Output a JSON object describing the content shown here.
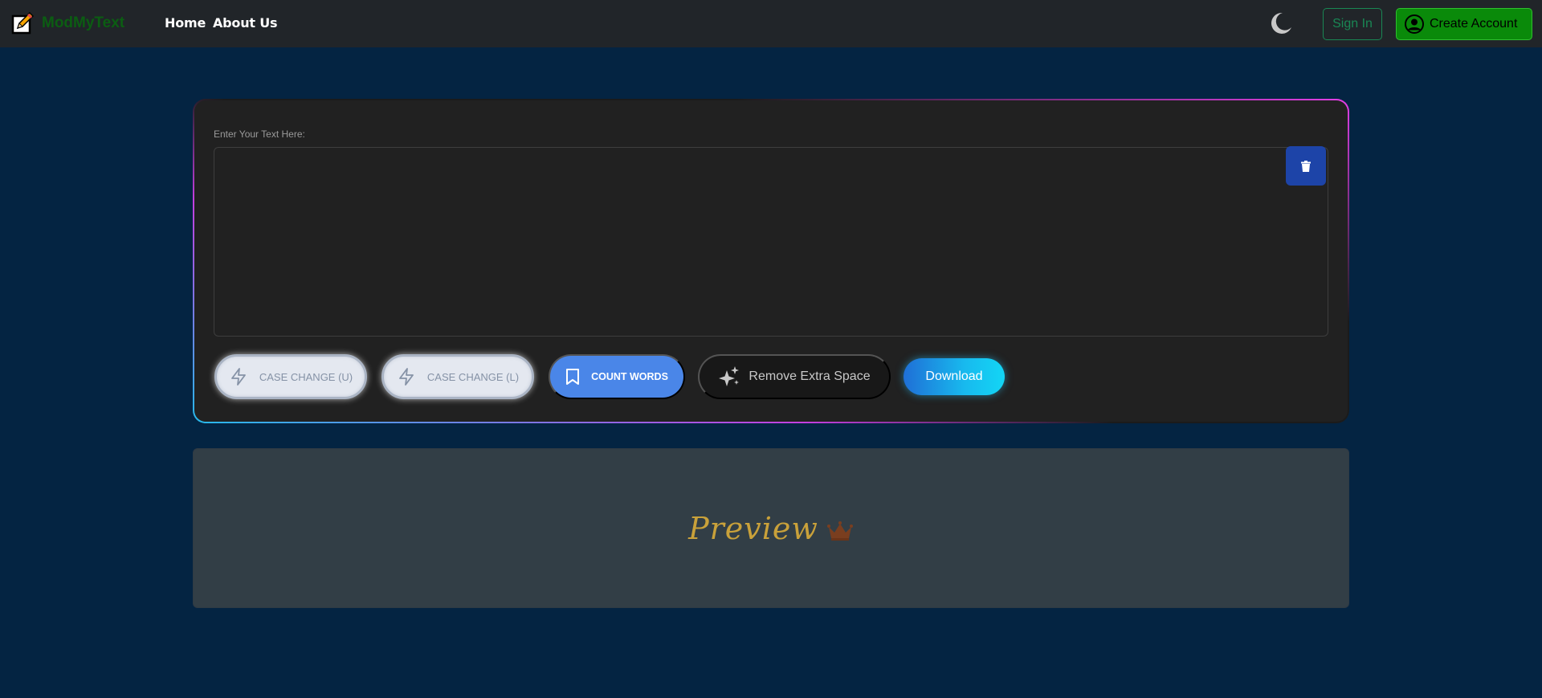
{
  "navbar": {
    "brand": "ModMyText",
    "links": [
      "Home",
      "About Us"
    ],
    "sign_in": "Sign In",
    "create_account": "Create Account"
  },
  "editor": {
    "label": "Enter Your Text Here:",
    "text_value": "",
    "buttons": {
      "case_upper": "CASE CHANGE (U)",
      "case_lower": "CASE CHANGE (L)",
      "count_words": "COUNT WORDS",
      "remove_space": "Remove Extra Space",
      "download": "Download"
    }
  },
  "preview": {
    "title": "Preview"
  },
  "icons": {
    "brand": "edit-note-icon",
    "theme": "moon-icon",
    "account": "user-circle-icon",
    "clear": "trash-icon",
    "case": "lightning-icon",
    "count": "bookmark-icon",
    "remove": "sparkles-icon",
    "preview": "crown-icon"
  },
  "colors": {
    "page_bg": "#042442",
    "navbar_bg": "#212529",
    "brand": "#0b5d12",
    "create_account_bg": "#0a8a0a",
    "sign_in": "#198754",
    "card_bg": "#212121",
    "count_words": "#4a86e8",
    "preview_bg": "#323e46",
    "preview_title": "#c9a13a"
  }
}
